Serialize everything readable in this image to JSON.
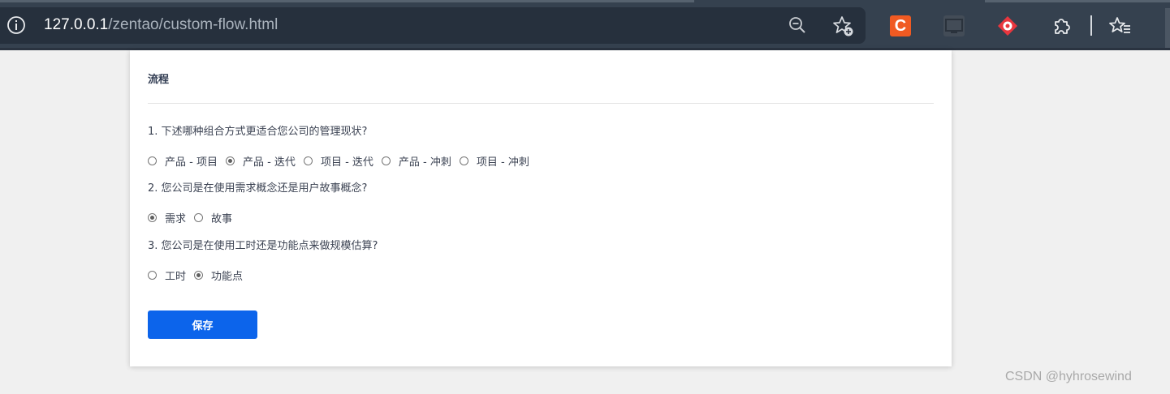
{
  "browser": {
    "url_host": "127.0.0.1",
    "url_path": "/zentao/custom-flow.html",
    "extension_c_label": "C"
  },
  "page": {
    "title": "流程",
    "questions": [
      {
        "text": "1. 下述哪种组合方式更适合您公司的管理现状?",
        "options": [
          "产品 - 项目",
          "产品 - 迭代",
          "项目 - 迭代",
          "产品 - 冲刺",
          "项目 - 冲刺"
        ],
        "selected": 1
      },
      {
        "text": "2. 您公司是在使用需求概念还是用户故事概念?",
        "options": [
          "需求",
          "故事"
        ],
        "selected": 0
      },
      {
        "text": "3. 您公司是在使用工时还是功能点来做规模估算?",
        "options": [
          "工时",
          "功能点"
        ],
        "selected": 1
      }
    ],
    "save_label": "保存"
  },
  "watermark": "CSDN @hyhrosewind",
  "colors": {
    "chrome": "#35414f",
    "omnibox": "#26303d",
    "primary_button": "#0c64eb",
    "page_background": "#f0f0f0"
  }
}
